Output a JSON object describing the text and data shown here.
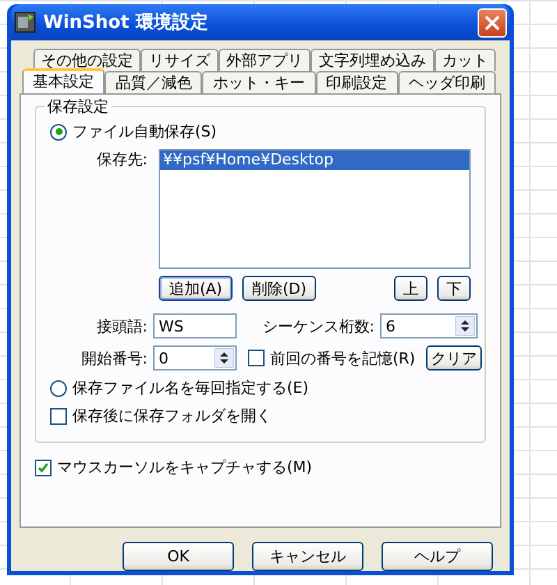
{
  "window": {
    "title": "WinShot 環境設定"
  },
  "tab_rows": [
    {
      "tabs": [
        {
          "label": "その他の設定",
          "selected": false
        },
        {
          "label": "リサイズ",
          "selected": false
        },
        {
          "label": "外部アプリ",
          "selected": false
        },
        {
          "label": "文字列埋め込み",
          "selected": false
        },
        {
          "label": "カット",
          "selected": false
        }
      ]
    },
    {
      "tabs": [
        {
          "label": "基本設定",
          "selected": true
        },
        {
          "label": "品質／減色",
          "selected": false
        },
        {
          "label": "ホット・キー",
          "selected": false
        },
        {
          "label": "印刷設定",
          "selected": false
        },
        {
          "label": "ヘッダ印刷",
          "selected": false
        }
      ]
    }
  ],
  "group": {
    "title": "保存設定",
    "auto_save": {
      "label": "ファイル自動保存(S)",
      "selected": true
    },
    "folder_label": "保存先:",
    "folders": [
      {
        "path": "¥¥psf¥Home¥Desktop",
        "selected": true
      }
    ],
    "list_buttons": [
      {
        "label": "追加(A)",
        "focused": true
      },
      {
        "label": "削除(D)",
        "focused": false
      }
    ],
    "order_buttons": [
      "上",
      "下"
    ],
    "prefix": {
      "label": "接頭語:",
      "value": "WS"
    },
    "digits": {
      "label": "シーケンス桁数:",
      "value": "6"
    },
    "start": {
      "label": "開始番号:",
      "value": "0"
    },
    "remember": {
      "label": "前回の番号を記憶(R)",
      "checked": false
    },
    "clear_button": "クリア",
    "ask_each": {
      "label": "保存ファイル名を毎回指定する(E)",
      "selected": false
    },
    "open_folder": {
      "label": "保存後に保存フォルダを開く",
      "checked": false
    }
  },
  "capture_cursor": {
    "label": "マウスカーソルをキャプチャする(M)",
    "checked": true
  },
  "dialog_buttons": [
    "OK",
    "キャンセル",
    "ヘルプ"
  ]
}
